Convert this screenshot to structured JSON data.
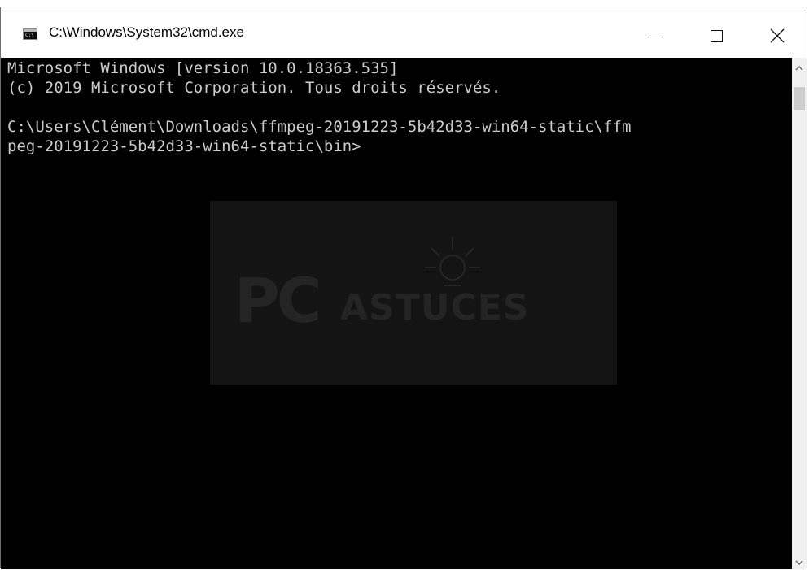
{
  "window": {
    "title": "C:\\Windows\\System32\\cmd.exe",
    "icon": "command-prompt-icon"
  },
  "caption_buttons": {
    "minimize": "minimize-icon",
    "maximize": "maximize-icon",
    "close": "close-icon"
  },
  "console": {
    "background": "#000000",
    "text_color": "#cccccc",
    "lines": [
      "Microsoft Windows [version 10.0.18363.535]",
      "(c) 2019 Microsoft Corporation. Tous droits réservés.",
      "",
      "C:\\Users\\Clément\\Downloads\\ffmpeg-20191223-5b42d33-win64-static\\ffm",
      "peg-20191223-5b42d33-win64-static\\bin>"
    ]
  },
  "watermark": {
    "brand_pc": "PC",
    "brand_astuces": "ASTUCES"
  },
  "scrollbar": {
    "up": "scroll-up-arrow-icon",
    "down": "scroll-down-arrow-icon"
  }
}
